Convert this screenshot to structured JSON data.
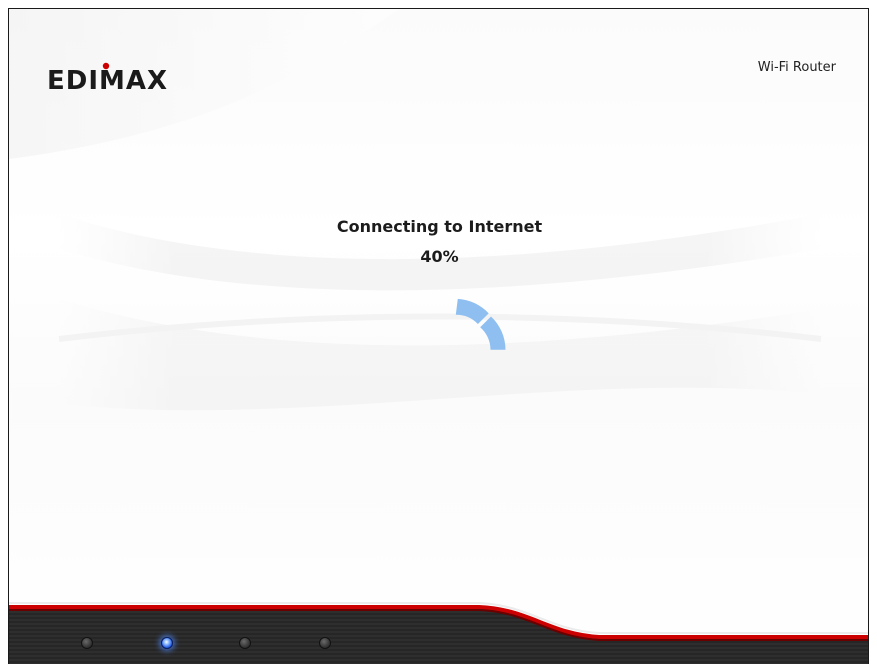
{
  "header": {
    "logo_text": "EDIMAX",
    "product_name": "Wi-Fi Router"
  },
  "status": {
    "title": "Connecting to Internet",
    "percent_label": "40%",
    "progress": 0.4
  },
  "leds": [
    {
      "name": "led-1",
      "state": "off"
    },
    {
      "name": "led-2",
      "state": "on"
    },
    {
      "name": "led-3",
      "state": "off"
    },
    {
      "name": "led-4",
      "state": "off"
    }
  ],
  "colors": {
    "spinner": "#8ebff0",
    "brand_red": "#cc0000",
    "footer_dark": "#2b2b2b",
    "led_active": "#2a63e8"
  }
}
